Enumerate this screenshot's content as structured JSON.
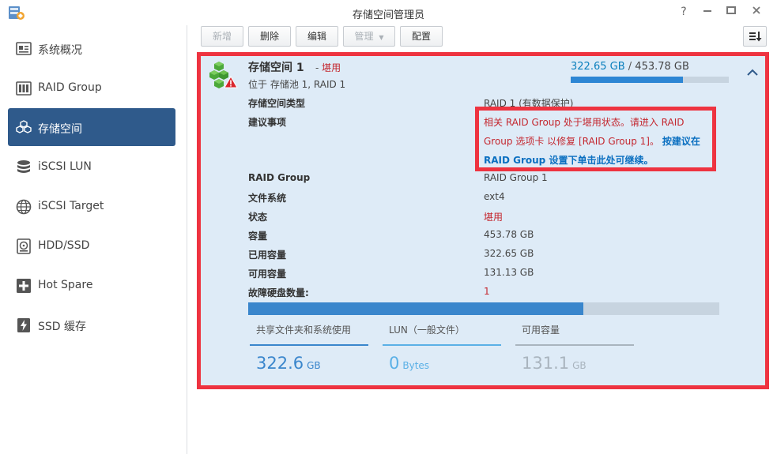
{
  "window": {
    "title": "存储空间管理员"
  },
  "sidebar": {
    "items": [
      {
        "label": "系统概况",
        "icon": "overview-icon"
      },
      {
        "label": "RAID Group",
        "icon": "raid-group-icon"
      },
      {
        "label": "存储空间",
        "icon": "volume-icon"
      },
      {
        "label": "iSCSI LUN",
        "icon": "iscsi-lun-icon"
      },
      {
        "label": "iSCSI Target",
        "icon": "iscsi-target-icon"
      },
      {
        "label": "HDD/SSD",
        "icon": "hdd-icon"
      },
      {
        "label": "Hot Spare",
        "icon": "hot-spare-icon"
      },
      {
        "label": "SSD 缓存",
        "icon": "ssd-cache-icon"
      }
    ],
    "active_index": 2
  },
  "toolbar": {
    "create": "新增",
    "delete": "删除",
    "edit": "编辑",
    "manage": "管理",
    "configure": "配置"
  },
  "volume": {
    "name": "存储空间 1",
    "status_sep": "-",
    "status": "堪用",
    "location": "位于 存储池 1, RAID 1",
    "capacity_used": "322.65 GB",
    "capacity_sep": "/",
    "capacity_total": "453.78 GB",
    "capacity_fraction": 0.711,
    "details": [
      {
        "label": "存储空间类型",
        "value": "RAID 1 (有数据保护)"
      },
      {
        "label": "建议事项",
        "value": ""
      },
      {
        "label": "RAID Group",
        "value": "RAID Group 1"
      },
      {
        "label": "文件系统",
        "value": "ext4"
      },
      {
        "label": "状态",
        "value": "堪用"
      },
      {
        "label": "容量",
        "value": "453.78 GB"
      },
      {
        "label": "已用容量",
        "value": "322.65 GB"
      },
      {
        "label": "可用容量",
        "value": "131.13 GB"
      },
      {
        "label": "故障硬盘数量:",
        "value": "1"
      }
    ],
    "advice": {
      "text": "相关 RAID Group 处于堪用状态。请进入 RAID Group 选项卡 以修复 [RAID Group 1]。",
      "link": "按建议在 RAID Group 设置下单击此处可继续。"
    },
    "usage_fraction": 0.711,
    "legend": [
      {
        "label": "共享文件夹和系统使用",
        "value": "322.6",
        "unit": "GB",
        "color": "#3a86cc"
      },
      {
        "label": "LUN（一般文件）",
        "value": "0",
        "unit": "Bytes",
        "color": "#5ab0e6"
      },
      {
        "label": "可用容量",
        "value": "131.1",
        "unit": "GB",
        "color": "#a9b4be"
      }
    ]
  }
}
